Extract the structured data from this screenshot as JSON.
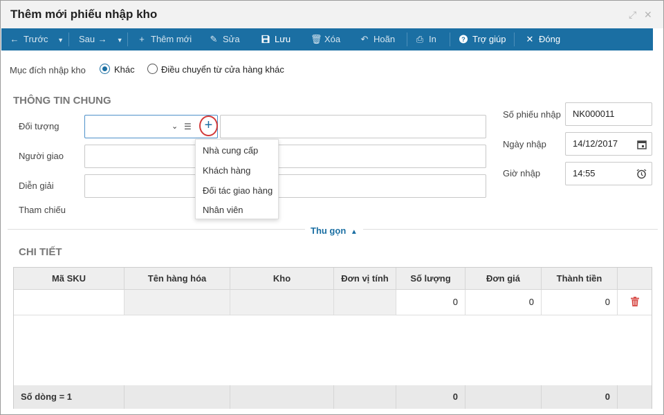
{
  "window": {
    "title": "Thêm mới phiếu nhập kho",
    "icons": [
      "expand-icon",
      "close-icon"
    ]
  },
  "toolbar": {
    "prev": "Trước",
    "next": "Sau",
    "add": "Thêm mới",
    "edit": "Sửa",
    "save": "Lưu",
    "delete": "Xóa",
    "undo": "Hoãn",
    "print": "In",
    "help": "Trợ giúp",
    "close": "Đóng"
  },
  "purpose": {
    "label": "Mục đích nhập kho",
    "options": [
      "Khác",
      "Điều chuyển từ cửa hàng khác"
    ],
    "selected": "Khác"
  },
  "general": {
    "section_title": "THÔNG TIN CHUNG",
    "object_label": "Đối tượng",
    "object_value": "",
    "object_name_value": "",
    "deliverer_label": "Người giao",
    "deliverer_value": "",
    "description_label": "Diễn giải",
    "description_value": "",
    "reference_label": "Tham chiếu",
    "voucher_no_label": "Số phiếu nhập",
    "voucher_no_value": "NK000011",
    "date_label": "Ngày nhập",
    "date_value": "14/12/2017",
    "time_label": "Giờ nhập",
    "time_value": "14:55"
  },
  "object_dropdown": {
    "items": [
      "Nhà cung cấp",
      "Khách hàng",
      "Đối tác giao hàng",
      "Nhân viên"
    ]
  },
  "collapse_label": "Thu gọn",
  "detail": {
    "section_title": "CHI TIẾT",
    "columns": [
      "Mã SKU",
      "Tên hàng hóa",
      "Kho",
      "Đơn vị tính",
      "Số lượng",
      "Đơn giá",
      "Thành tiền"
    ],
    "rows": [
      {
        "sku": "",
        "name": "",
        "warehouse": "",
        "unit": "",
        "quantity": "0",
        "price": "0",
        "amount": "0"
      }
    ],
    "footer": {
      "row_count": "Số dòng = 1",
      "total_quantity": "0",
      "total_amount": "0"
    }
  },
  "colors": {
    "toolbar_bg": "#1b6fa3",
    "accent": "#1b6fa3",
    "delete_icon": "#d9534f",
    "highlight_ring": "#d23a3a"
  }
}
